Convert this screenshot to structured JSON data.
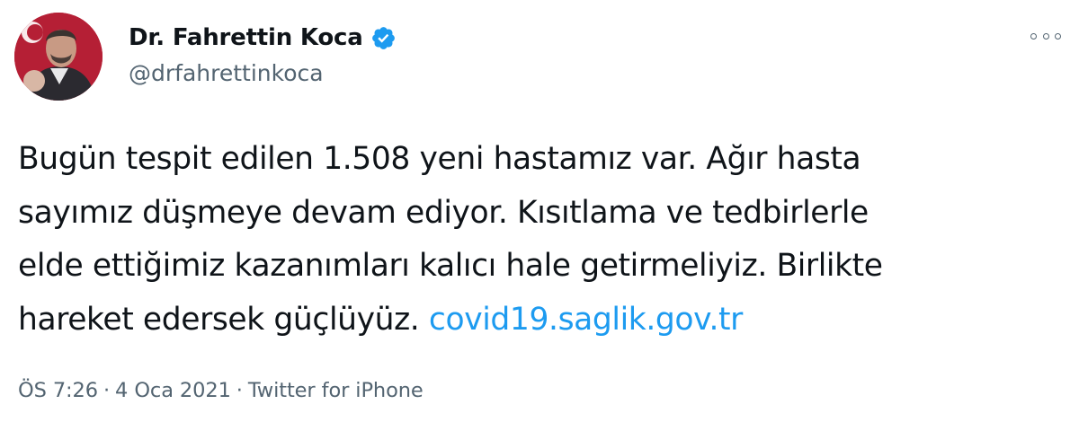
{
  "author": {
    "name": "Dr. Fahrettin Koca",
    "handle": "@drfahrettinkoca",
    "verified": true,
    "avatar_icon": "profile-photo",
    "verified_color": "#1d9bf0"
  },
  "tweet": {
    "lines": [
      "Bugün tespit edilen 1.508 yeni hastamız var. Ağır hasta",
      "sayımız düşmeye devam ediyor. Kısıtlama ve tedbirlerle",
      "elde ettiğimiz kazanımları kalıcı hale getirmeliyiz. Birlikte",
      "hareket edersek güçlüyüz. "
    ],
    "link_text": "covid19.saglik.gov.tr",
    "link_color": "#1d9bf0"
  },
  "meta": {
    "time": "ÖS 7:26",
    "date": "4 Oca 2021",
    "separator": "·",
    "source": "Twitter for iPhone"
  },
  "more_icon": "more-options-icon"
}
